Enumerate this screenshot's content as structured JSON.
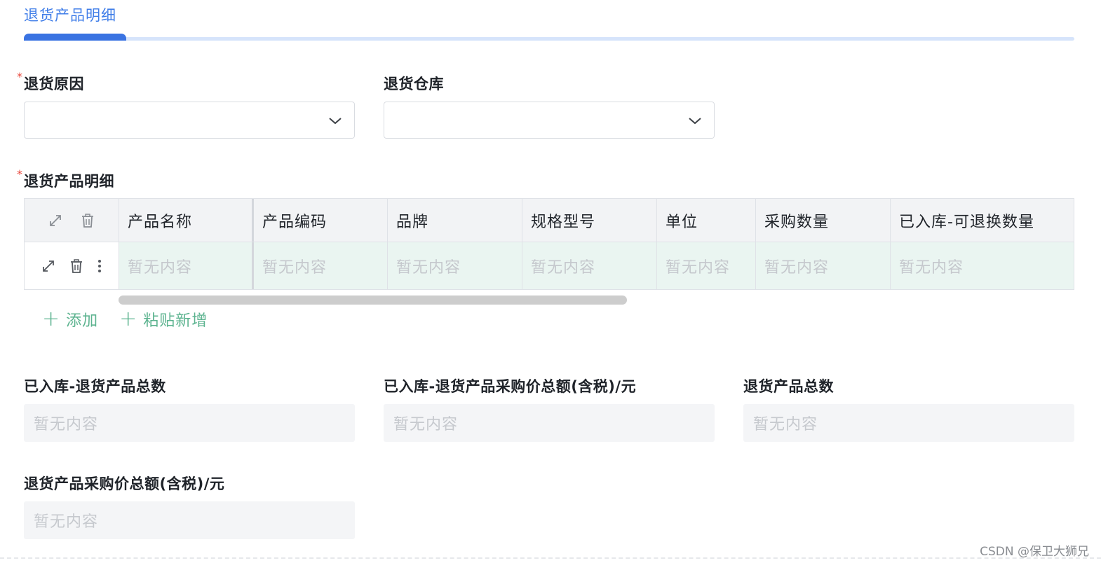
{
  "section": {
    "title": "退货产品明细"
  },
  "form": {
    "return_reason": {
      "label": "退货原因",
      "required_mark": "*",
      "value": ""
    },
    "return_warehouse": {
      "label": "退货仓库",
      "value": ""
    },
    "detail_table": {
      "label": "退货产品明细",
      "required_mark": "*",
      "columns": [
        "产品名称",
        "产品编码",
        "品牌",
        "规格型号",
        "单位",
        "采购数量",
        "已入库-可退换数量"
      ],
      "rows": [
        [
          "暂无内容",
          "暂无内容",
          "暂无内容",
          "暂无内容",
          "暂无内容",
          "暂无内容",
          "暂无内容"
        ]
      ],
      "actions": {
        "add": "添加",
        "paste_add": "粘贴新增"
      }
    },
    "summary": {
      "stocked_return_total": {
        "label": "已入库-退货产品总数",
        "value": "暂无内容"
      },
      "stocked_return_amount": {
        "label": "已入库-退货产品采购价总额(含税)/元",
        "value": "暂无内容"
      },
      "return_total": {
        "label": "退货产品总数",
        "value": "暂无内容"
      },
      "return_amount": {
        "label": "退货产品采购价总额(含税)/元",
        "value": "暂无内容"
      }
    }
  },
  "watermark": "CSDN @保卫大狮兄",
  "colors": {
    "accent": "#3a73e2",
    "add_action": "#5cb38f",
    "required": "#e8463a",
    "row_highlight": "#eaf5f1"
  }
}
